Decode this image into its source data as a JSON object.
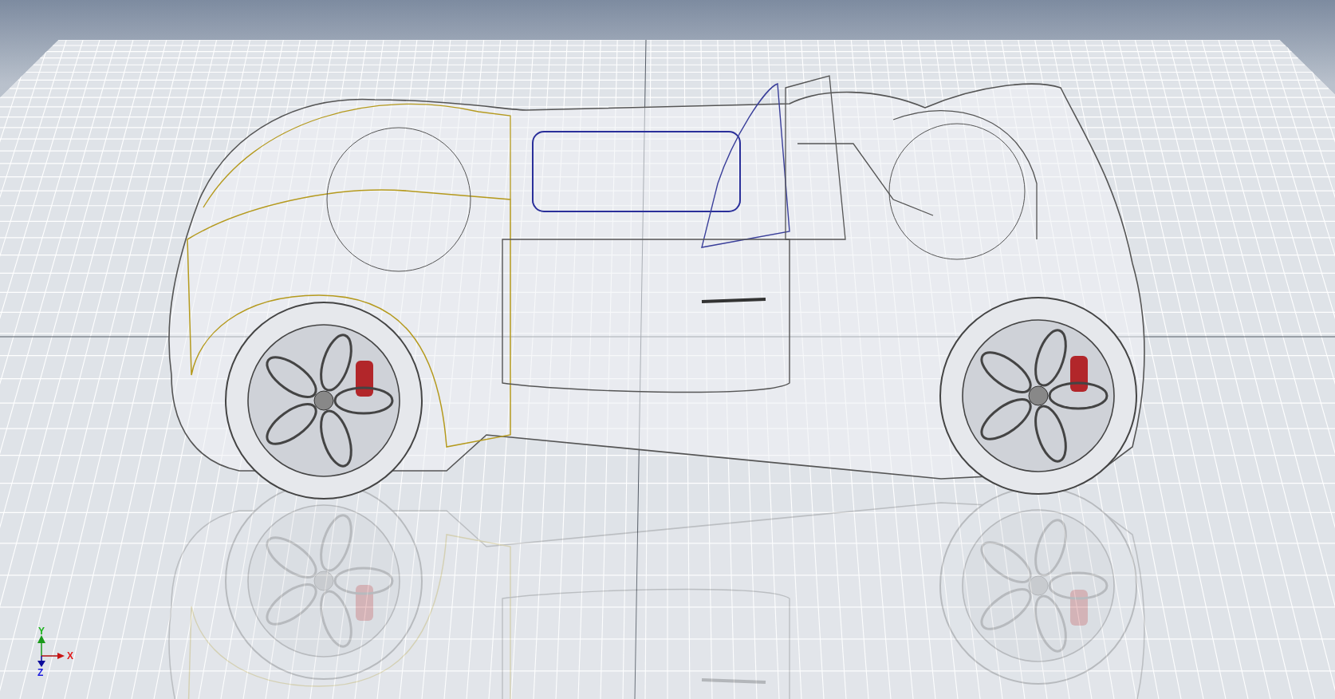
{
  "viewport": {
    "axis_triad": {
      "labels": [
        {
          "kind": "y",
          "text": "Y"
        },
        {
          "kind": "x",
          "text": "X"
        },
        {
          "kind": "z",
          "text": "Z"
        }
      ]
    }
  }
}
